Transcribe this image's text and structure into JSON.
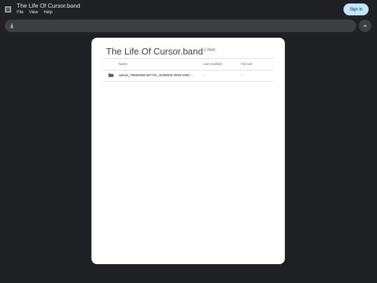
{
  "app": {
    "title": "The Life Of Cursor.band",
    "menu": [
      "File",
      "View",
      "Help"
    ],
    "sign_in_label": "Sign in"
  },
  "panel": {
    "title": "The Life Of Cursor.band",
    "count": "1 item",
    "columns": {
      "name": "Name",
      "modified": "Last modified",
      "size": "File size"
    },
    "rows": [
      {
        "name": "upload_795882590.68770e_4b499936-3E83-4298-...",
        "modified": "-",
        "size": "-"
      }
    ]
  },
  "icons": {
    "app": "document-icon",
    "download": "download-icon",
    "collapse": "chevron-up-icon",
    "folder": "folder-icon"
  },
  "colors": {
    "background": "#202124",
    "toolbar": "#3c4043",
    "sign_in_button": "#c2e7ff",
    "panel": "#ffffff"
  }
}
